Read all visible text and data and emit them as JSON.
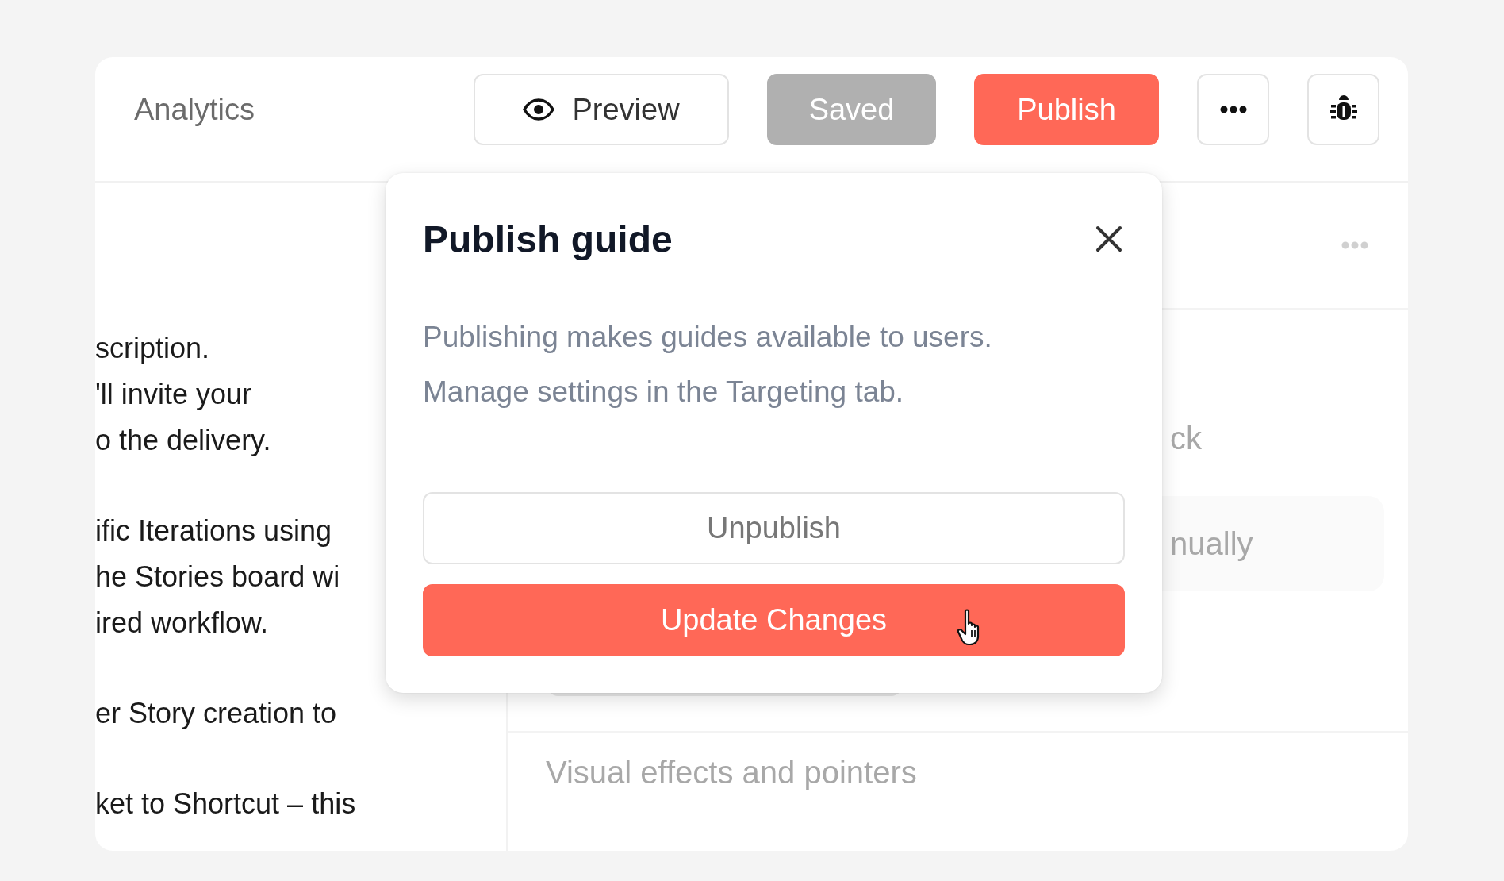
{
  "header": {
    "title": "Analytics",
    "buttons": [
      {
        "kind": "preview",
        "label": "Preview",
        "disabled": false
      },
      {
        "kind": "status",
        "label": "Saved",
        "disabled": true
      },
      {
        "kind": "primary",
        "label": "Publish",
        "disabled": false
      },
      {
        "kind": "more",
        "disabled": false
      },
      {
        "kind": "debug",
        "disabled": false
      }
    ]
  },
  "left_pane": {
    "paragraphs": [
      [
        "scription.",
        "'ll invite your",
        "o the delivery."
      ],
      [
        "ific Iterations using",
        "he Stories board wi",
        "ired workflow."
      ],
      [
        "er Story creation to"
      ],
      [
        "ket to Shortcut – this"
      ]
    ]
  },
  "right_pane": {
    "texts": [
      "ck",
      "nually",
      "Visual effects and pointers"
    ]
  },
  "dialog": {
    "title": "Publish guide",
    "lines": [
      "Publishing makes guides available to users.",
      "Manage settings in the Targeting tab."
    ],
    "buttons": [
      {
        "kind": "secondary",
        "label": "Unpublish"
      },
      {
        "kind": "primary",
        "label": "Update Changes",
        "hovered": true
      }
    ]
  }
}
